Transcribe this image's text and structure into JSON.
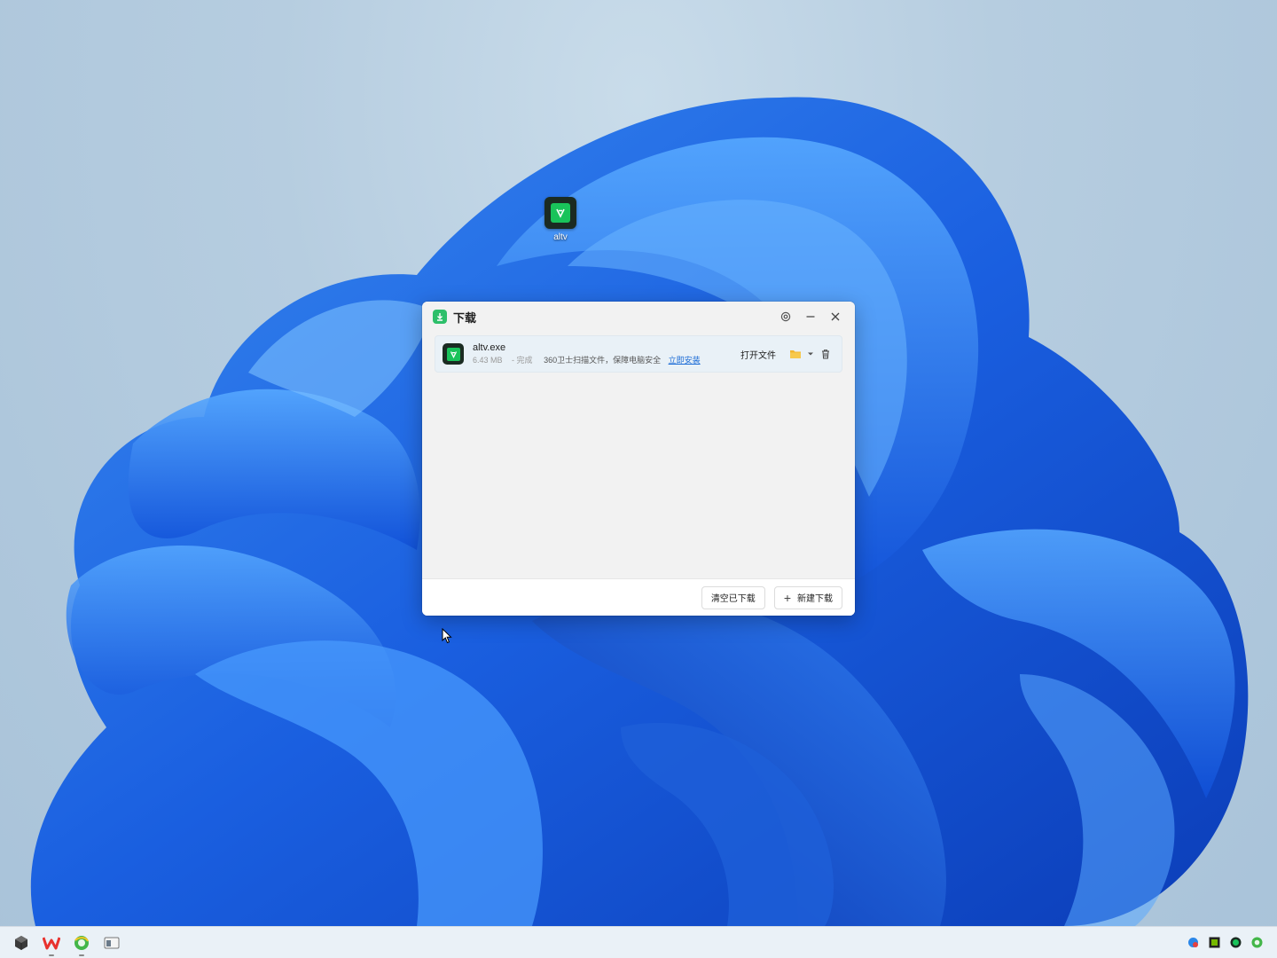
{
  "desktop": {
    "icon_label": "altv"
  },
  "window": {
    "title": "下载",
    "item": {
      "filename": "altv.exe",
      "size": "6.43 MB",
      "status": "- 完成",
      "scan_note": "360卫士扫描文件，保障电脑安全",
      "install_link": "立即安装",
      "open_label": "打开文件"
    },
    "footer": {
      "clear_label": "清空已下载",
      "new_label": "新建下载"
    }
  },
  "colors": {
    "accent_green": "#2dbf6a",
    "link_blue": "#1a6bd6",
    "folder_yellow": "#f2b632"
  }
}
